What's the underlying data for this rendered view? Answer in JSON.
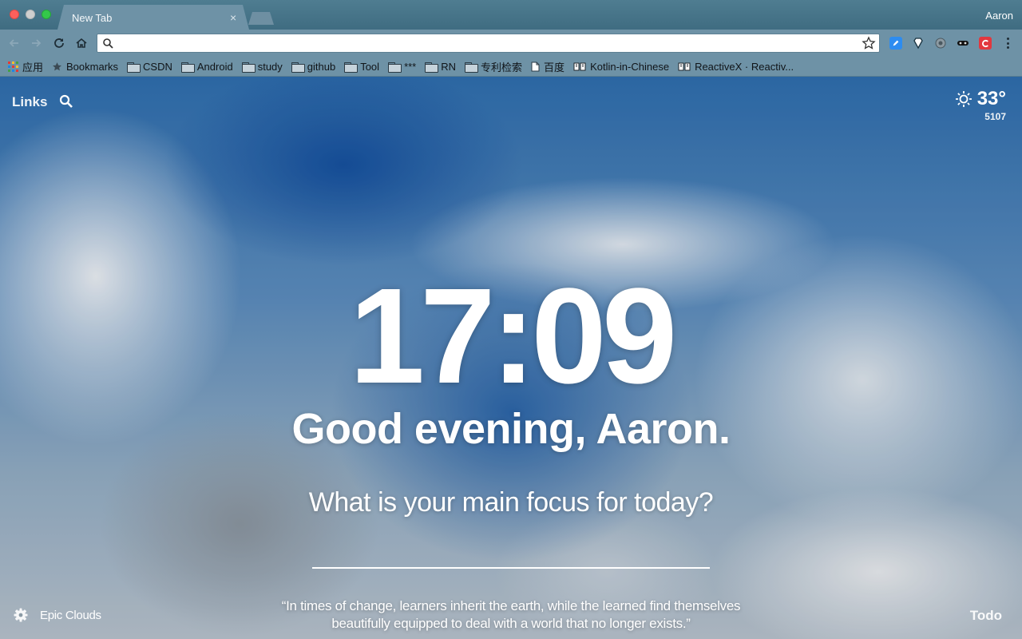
{
  "browser": {
    "profile_name": "Aaron",
    "tab": {
      "title": "New Tab",
      "close_glyph": "×"
    },
    "omnibox": {
      "value": "",
      "placeholder": ""
    }
  },
  "bookmarks": {
    "apps_label": "应用",
    "items": [
      {
        "label": "Bookmarks",
        "icon": "star-icon"
      },
      {
        "label": "CSDN",
        "icon": "folder-icon"
      },
      {
        "label": "Android",
        "icon": "folder-icon"
      },
      {
        "label": "study",
        "icon": "folder-icon"
      },
      {
        "label": "github",
        "icon": "folder-icon"
      },
      {
        "label": "Tool",
        "icon": "folder-icon"
      },
      {
        "label": "***",
        "icon": "folder-icon"
      },
      {
        "label": "RN",
        "icon": "folder-icon"
      },
      {
        "label": "专利检索",
        "icon": "folder-icon"
      },
      {
        "label": "百度",
        "icon": "page-icon"
      },
      {
        "label": "Kotlin-in-Chinese",
        "icon": "book-icon"
      },
      {
        "label": "ReactiveX · Reactiv...",
        "icon": "book-icon"
      }
    ]
  },
  "momentum": {
    "links_label": "Links",
    "weather": {
      "temperature": "33°",
      "location": "5107",
      "icon": "sun-icon"
    },
    "clock": "17:09",
    "greeting": "Good evening, Aaron.",
    "focus_prompt": "What is your main focus for today?",
    "focus_value": "",
    "photo_credit": "Epic Clouds",
    "quote_line1": "“In times of change, learners inherit the earth, while the learned find themselves",
    "quote_line2": "beautifully equipped to deal with a world that no longer exists.”",
    "todo_label": "Todo"
  },
  "colors": {
    "chrome_frame": "#6e92a6",
    "tabbar": "#4f7d91",
    "close": "#fc605c",
    "minimize": "#cfcfcf",
    "maximize": "#34c84a"
  }
}
